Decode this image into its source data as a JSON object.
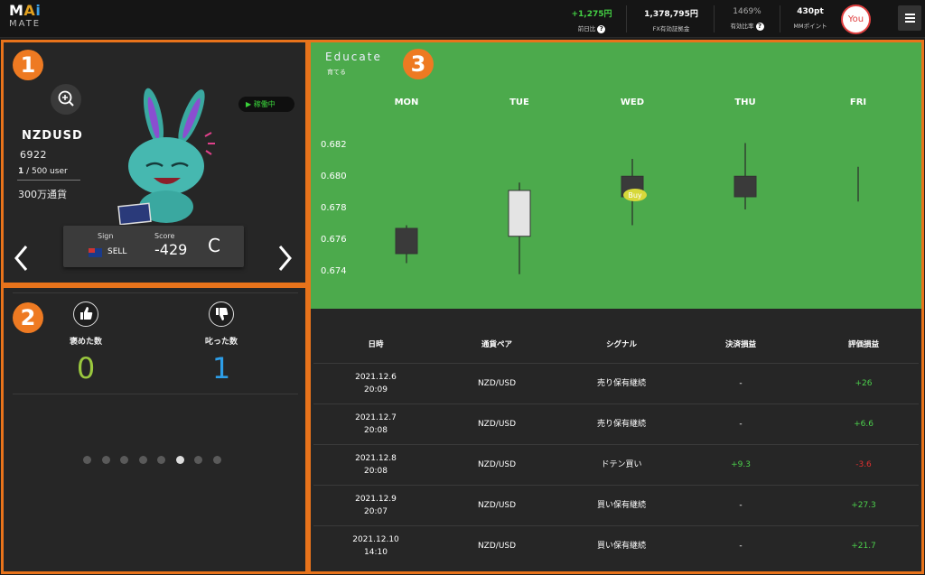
{
  "header": {
    "logo_top": "MAi",
    "logo_bottom": "MATE",
    "stats": [
      {
        "value": "+1,275円",
        "label": "前日比"
      },
      {
        "value": "1,378,795円",
        "label": "FX有効証拠金"
      },
      {
        "value": "1469%",
        "label": "有効比率"
      },
      {
        "value": "430pt",
        "label": "MMポイント"
      }
    ],
    "user_label": "You"
  },
  "panel1": {
    "badge": "1",
    "running": "稼働中",
    "pair": "NZDUSD",
    "number": "6922",
    "users_current": "1",
    "users_total": " / 500 user",
    "volume": "300万通貨",
    "sign_label": "Sign",
    "sign_value": "SELL",
    "score_label": "Score",
    "score_value": "-429",
    "grade": "C"
  },
  "panel2": {
    "badge": "2",
    "praised_label": "褒めた数",
    "praised_count": "0",
    "scolded_label": "叱った数",
    "scolded_count": "1",
    "dots": 8,
    "active_dot": 5
  },
  "panel3": {
    "badge": "3",
    "title": "Educate",
    "subtitle": "育てる",
    "buy_marker": "Buy",
    "colors": {
      "chart_bg": "#4caa4c",
      "bull": "#e4e4e4",
      "bear": "#3a3a3a",
      "buy": "#d7d83a"
    },
    "chart_data": {
      "type": "candlestick",
      "categories": [
        "MON",
        "TUE",
        "WED",
        "THU",
        "FRI"
      ],
      "y_ticks": [
        "0.682",
        "0.680",
        "0.678",
        "0.676",
        "0.674"
      ],
      "ylim": [
        0.6735,
        0.6835
      ],
      "candles": [
        {
          "day": "MON",
          "open": 0.6768,
          "close": 0.6752,
          "high": 0.677,
          "low": 0.6746
        },
        {
          "day": "TUE",
          "open": 0.6763,
          "close": 0.6792,
          "high": 0.6797,
          "low": 0.6739
        },
        {
          "day": "WED",
          "open": 0.6801,
          "close": 0.6788,
          "high": 0.6812,
          "low": 0.677
        },
        {
          "day": "THU",
          "open": 0.6801,
          "close": 0.6788,
          "high": 0.6822,
          "low": 0.678
        },
        {
          "day": "FRI",
          "open": 0.6797,
          "close": 0.6797,
          "high": 0.6807,
          "low": 0.6785
        }
      ],
      "buy_signal_day": "WED"
    },
    "table": {
      "headers": [
        "日時",
        "通貨ペア",
        "シグナル",
        "決済損益",
        "評価損益"
      ],
      "rows": [
        {
          "datetime": "2021.12.6\n20:09",
          "pair": "NZD/USD",
          "signal": "売り保有継続",
          "settled": "-",
          "valuation": "+26"
        },
        {
          "datetime": "2021.12.7\n20:08",
          "pair": "NZD/USD",
          "signal": "売り保有継続",
          "settled": "-",
          "valuation": "+6.6"
        },
        {
          "datetime": "2021.12.8\n20:08",
          "pair": "NZD/USD",
          "signal": "ドテン買い",
          "settled": "+9.3",
          "valuation": "-3.6"
        },
        {
          "datetime": "2021.12.9\n20:07",
          "pair": "NZD/USD",
          "signal": "買い保有継続",
          "settled": "-",
          "valuation": "+27.3"
        },
        {
          "datetime": "2021.12.10\n14:10",
          "pair": "NZD/USD",
          "signal": "買い保有継続",
          "settled": "-",
          "valuation": "+21.7"
        }
      ]
    }
  }
}
